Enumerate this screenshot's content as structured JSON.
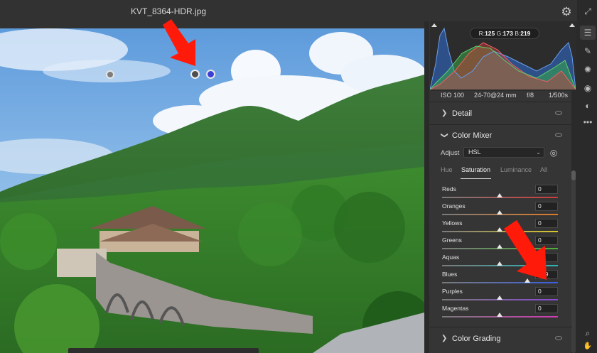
{
  "window": {
    "filename": "KVT_8364-HDR.jpg"
  },
  "histogram": {
    "r_label": "R:",
    "r_value": "125",
    "g_label": "G:",
    "g_value": "173",
    "b_label": "B:",
    "b_value": "219"
  },
  "exif": {
    "iso": "ISO 100",
    "lens": "24-70@24 mm",
    "aperture": "f/8",
    "shutter": "1/500s"
  },
  "sections": {
    "detail": "Detail",
    "color_mixer": "Color Mixer",
    "color_grading": "Color Grading"
  },
  "mixer": {
    "adjust_label": "Adjust",
    "adjust_value": "HSL",
    "tabs": [
      "Hue",
      "Saturation",
      "Luminance",
      "All"
    ],
    "active_tab": "Saturation",
    "rows": [
      {
        "label": "Reds",
        "value": "0",
        "level": 0,
        "color": "#d23a3a"
      },
      {
        "label": "Oranges",
        "value": "0",
        "level": 0,
        "color": "#e07a26"
      },
      {
        "label": "Yellows",
        "value": "0",
        "level": 0,
        "color": "#d9c52c"
      },
      {
        "label": "Greens",
        "value": "0",
        "level": 0,
        "color": "#4caf3a"
      },
      {
        "label": "Aquas",
        "value": "0",
        "level": 0,
        "color": "#2ab7b7"
      },
      {
        "label": "Blues",
        "value": "+69",
        "level": 69,
        "color": "#3a5fe0"
      },
      {
        "label": "Purples",
        "value": "0",
        "level": 0,
        "color": "#8a4ad6"
      },
      {
        "label": "Magentas",
        "value": "0",
        "level": 0,
        "color": "#d23ab8"
      }
    ]
  },
  "icons": {
    "settings": "gear-icon",
    "tools": [
      "expand-icon",
      "edit-sliders-icon",
      "brush-icon",
      "heal-icon",
      "red-eye-icon",
      "masking-icon",
      "more-icon",
      "zoom-icon"
    ]
  },
  "colors": {
    "accent_red": "#ff1a0a",
    "panel_bg": "#353535"
  }
}
